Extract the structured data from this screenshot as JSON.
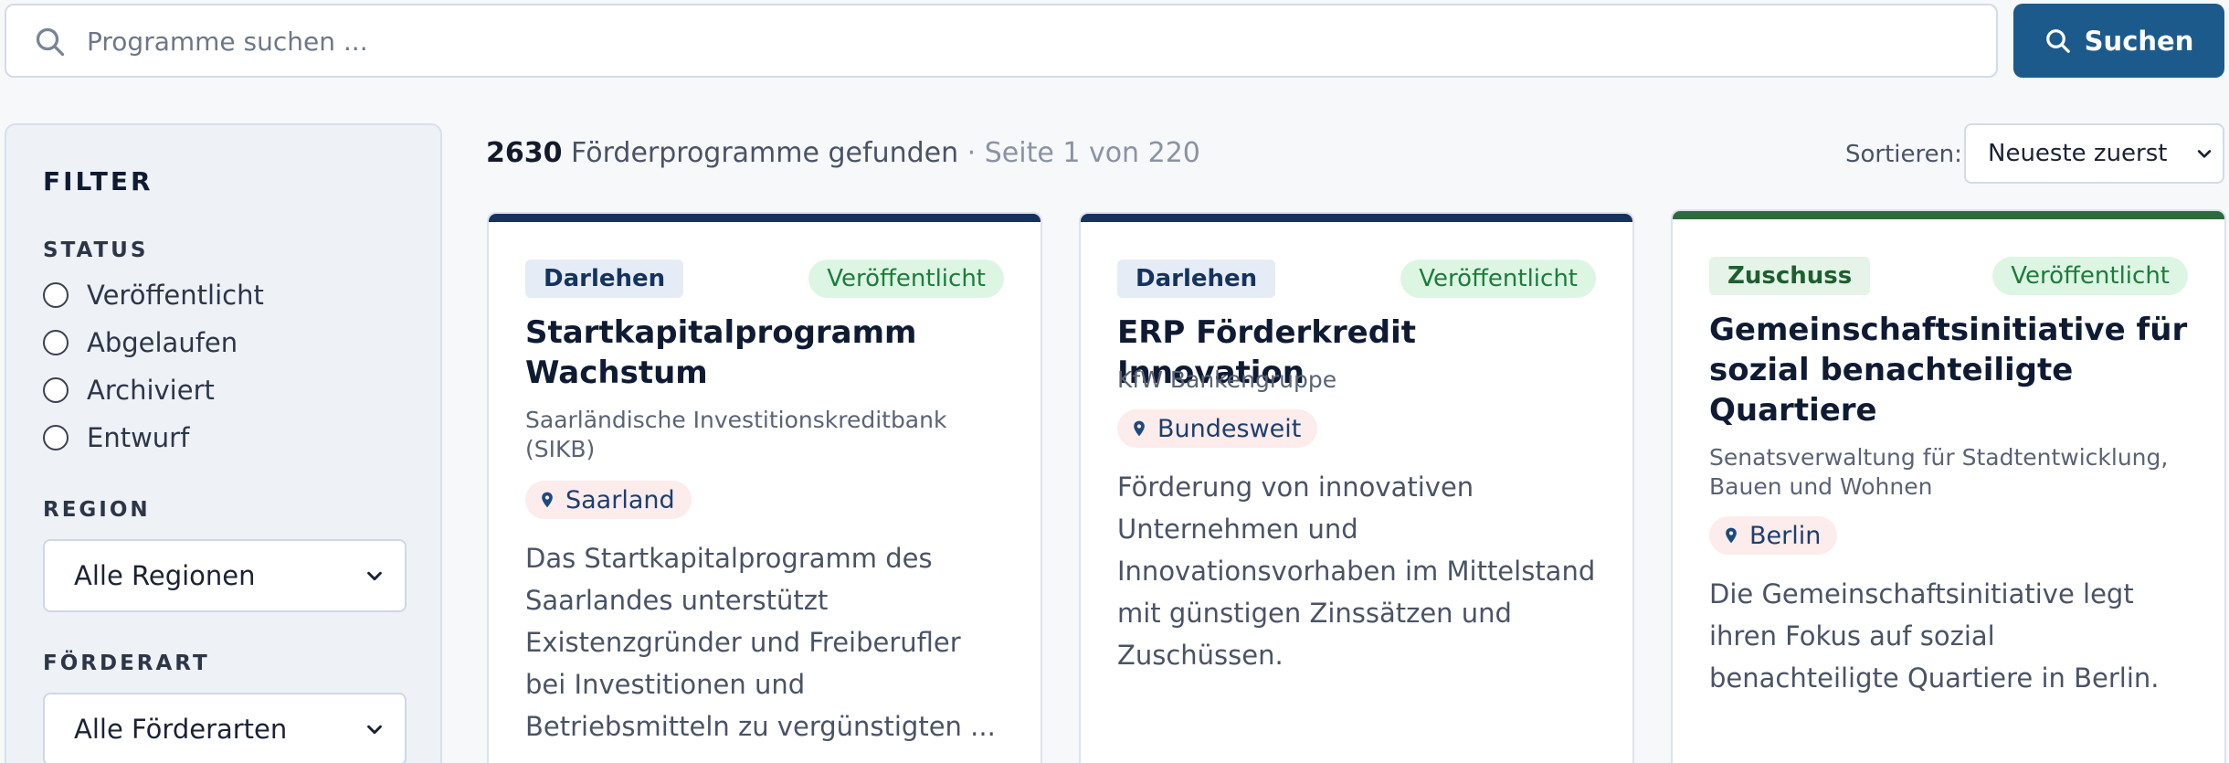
{
  "search": {
    "placeholder": "Programme suchen ...",
    "button_label": "Suchen"
  },
  "filter": {
    "title": "FILTER",
    "status_title": "STATUS",
    "status_options": [
      "Veröffentlicht",
      "Abgelaufen",
      "Archiviert",
      "Entwurf"
    ],
    "region_title": "REGION",
    "region_value": "Alle Regionen",
    "type_title": "FÖRDERART",
    "type_value": "Alle Förderarten"
  },
  "results": {
    "count": "2630",
    "count_label": "Förderprogramme gefunden",
    "page_info": "· Seite 1 von 220",
    "sort_label": "Sortieren:",
    "sort_value": "Neueste zuerst"
  },
  "colors": {
    "primary": "#1c5a8c",
    "darlehen_bar": "#14335e",
    "zuschuss_bar": "#2e6b3c"
  },
  "cards": [
    {
      "type": "Darlehen",
      "status": "Veröffentlicht",
      "title": "Startkapitalprogramm Wachstum",
      "org": "Saarländische Investitionskreditbank (SIKB)",
      "region": "Saarland",
      "description": "Das Startkapitalprogramm des Saarlandes unterstützt Existenzgründer und Freiberufler bei Investitionen und Betriebsmitteln zu vergünstigten ..."
    },
    {
      "type": "Darlehen",
      "status": "Veröffentlicht",
      "title": "ERP Förderkredit Innovation",
      "org": "KfW Bankengruppe",
      "region": "Bundesweit",
      "description": "Förderung von innovativen Unternehmen und Innovationsvorhaben im Mittelstand mit günstigen Zinssätzen und Zuschüssen."
    },
    {
      "type": "Zuschuss",
      "status": "Veröffentlicht",
      "title": "Gemeinschaftsinitiative für sozial benachteiligte Quartiere",
      "org": "Senatsverwaltung für Stadtentwicklung, Bauen und Wohnen",
      "region": "Berlin",
      "description": "Die Gemeinschaftsinitiative legt ihren Fokus auf sozial benachteiligte Quartiere in Berlin."
    }
  ]
}
